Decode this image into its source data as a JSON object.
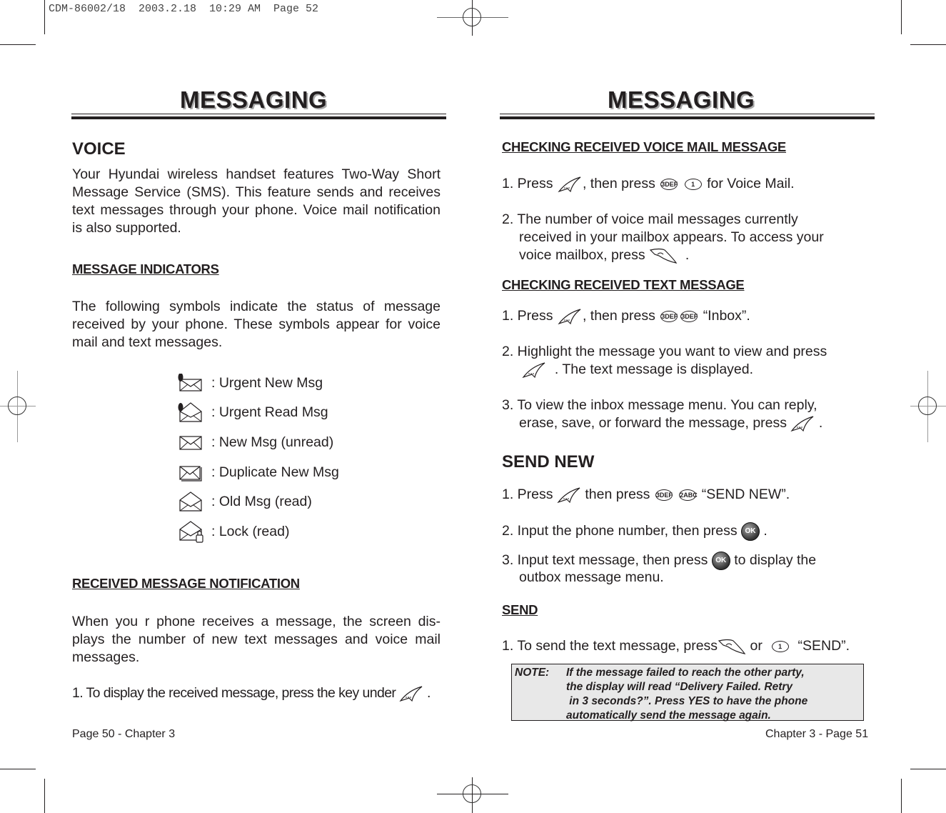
{
  "print_slug": "CDM-86002/18  2003.2.18  10:29 AM  Page 52",
  "left_page": {
    "title": "MESSAGING",
    "voice_heading": "VOICE",
    "intro": "Your Hyundai wireless handset features Two-Way Short Message Service (SMS). This feature sends and receives text messages through your phone. Voice mail notification is also supported.",
    "indicators_heading": "MESSAGE INDICATORS",
    "indicators_intro": "The following symbols indicate the status of message received by your phone. These symbols appear for voice mail and text messages.",
    "indicators": [
      {
        "icon": "urgent-new-msg-icon",
        "label": ": Urgent New Msg"
      },
      {
        "icon": "urgent-read-msg-icon",
        "label": ": Urgent Read Msg"
      },
      {
        "icon": "new-msg-icon",
        "label": ": New Msg (unread)"
      },
      {
        "icon": "duplicate-new-msg-icon",
        "label": ": Duplicate New Msg"
      },
      {
        "icon": "old-msg-icon",
        "label": ": Old Msg (read)"
      },
      {
        "icon": "lock-read-icon",
        "label": ": Lock (read)"
      }
    ],
    "notification_heading": "RECEIVED MESSAGE NOTIFICATION",
    "notification_text": "When you r phone receives a message, the screen dis-plays the number of new text messages and voice mail messages.",
    "notification_step1": "1. To display the received message, press the key under",
    "notification_step1_end": ".",
    "footer": "Page 50 - Chapter 3"
  },
  "right_page": {
    "title": "MESSAGING",
    "voicemail_heading": "CHECKING RECEIVED VOICE MAIL MESSAGE",
    "vm_step1_a": "1. Press",
    "vm_step1_b": ", then press",
    "vm_step1_keys": [
      "3DEF",
      "1"
    ],
    "vm_step1_c": "for Voice Mail.",
    "vm_step2_l1": "2. The number of voice mail messages currently",
    "vm_step2_l2": "received in your mailbox appears. To access your",
    "vm_step2_l3": "voice mailbox, press",
    "vm_step2_end": ".",
    "text_heading": "CHECKING RECEIVED TEXT MESSAGE",
    "tm_step1_a": "1. Press",
    "tm_step1_b": ", then press",
    "tm_step1_keys": [
      "3DEF",
      "3DEF"
    ],
    "tm_step1_c": "“Inbox”.",
    "tm_step2_l1": "2. Highlight the message you want to view and press",
    "tm_step2_l2": ". The text message is displayed.",
    "tm_step3_l1": "3. To view the inbox message menu. You can reply,",
    "tm_step3_l2": "erase, save, or forward the message, press",
    "tm_step3_end": ".",
    "send_new_heading": "SEND NEW",
    "sn_step1_a": "1. Press",
    "sn_step1_b": "then press",
    "sn_step1_keys": [
      "3DEF",
      "2ABC"
    ],
    "sn_step1_c": "“SEND NEW”.",
    "sn_step2": "2. Input the phone number, then press",
    "sn_step2_end": ".",
    "sn_step3_a": "3. Input text message, then press",
    "sn_step3_b": "to display the",
    "sn_step3_l2": "outbox message menu.",
    "ok_label": "OK",
    "send_heading": "SEND",
    "send_step1_a": "1. To send the text message, press",
    "send_step1_or": "or",
    "send_step1_key": "1",
    "send_step1_c": "“SEND”.",
    "note_label": "NOTE:",
    "note_text": "If the message failed to reach the other party,\nthe display will read “Delivery Failed. Retry\n in 3 seconds?”. Press YES to have the phone\nautomatically send the message again.",
    "footer": "Chapter 3 - Page 51"
  }
}
